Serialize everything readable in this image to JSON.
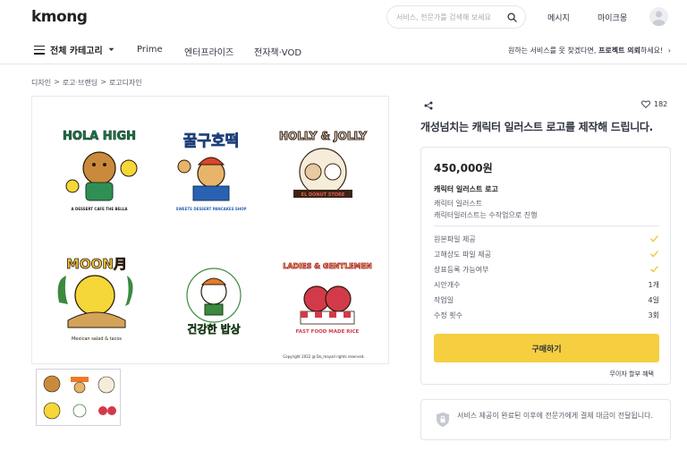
{
  "header": {
    "logo": "kmong",
    "search": {
      "placeholder": "서비스, 전문가를 검색해 보세요"
    },
    "links": [
      "메시지",
      "마이크몽"
    ]
  },
  "nav": {
    "category_label": "전체 카테고리",
    "items": [
      "Prime",
      "엔터프라이즈",
      "전자책·VOD"
    ],
    "promo_prefix": "원하는 서비스를 못 찾겠다면, ",
    "promo_bold": "프로젝트 의뢰",
    "promo_suffix": "하세요!"
  },
  "breadcrumb": [
    "디자인",
    ">",
    "로고·브랜딩",
    ">",
    "로고디자인"
  ],
  "gallery": {
    "logos": [
      {
        "text": "HOLA HIGH",
        "sub": "A DESSERT CAFE THE BELLA"
      },
      {
        "text": "꿀구호떡",
        "sub": "SWEETS DESSERT PANCAKES SHOP"
      },
      {
        "text": "HOLLY & JOLLY",
        "sub": "EL DONUT STORE"
      },
      {
        "text": "MOON月",
        "sub": "Mexican salad & tacos"
      },
      {
        "text": "건강한 밥상",
        "sub": ""
      },
      {
        "text": "LADIES & GENTLEMEN",
        "sub": "FAST FOOD MADE RICE"
      }
    ],
    "copyright": "Copyright 2022 @ Do_mayall rights reserved."
  },
  "product": {
    "likes": "182",
    "title": "개성넘치는 캐릭터 일러스트 로고를 제작해 드립니다.",
    "price": "450,000원",
    "package_name": "캐릭터 일러스트 로고",
    "package_lines": [
      "캐릭터 일러스트",
      "캐릭터일러스트는 수작업으로 진행"
    ],
    "features": [
      {
        "label": "원본파일 제공",
        "value": "",
        "check": true
      },
      {
        "label": "고해상도 파일 제공",
        "value": "",
        "check": true
      },
      {
        "label": "상표등록 가능여부",
        "value": "",
        "check": true
      },
      {
        "label": "시안개수",
        "value": "1개",
        "check": false
      },
      {
        "label": "작업일",
        "value": "4일",
        "check": false
      },
      {
        "label": "수정 횟수",
        "value": "3회",
        "check": false
      }
    ],
    "buy_label": "구매하기",
    "no_interest": "무이자 할부 혜택"
  },
  "notice": {
    "text": "서비스 제공이 완료된 이후에 전문가에게 결제 대금이 전달됩니다."
  },
  "colors": {
    "accent": "#f5cf3f",
    "check": "#f0c52e",
    "text": "#303441"
  }
}
